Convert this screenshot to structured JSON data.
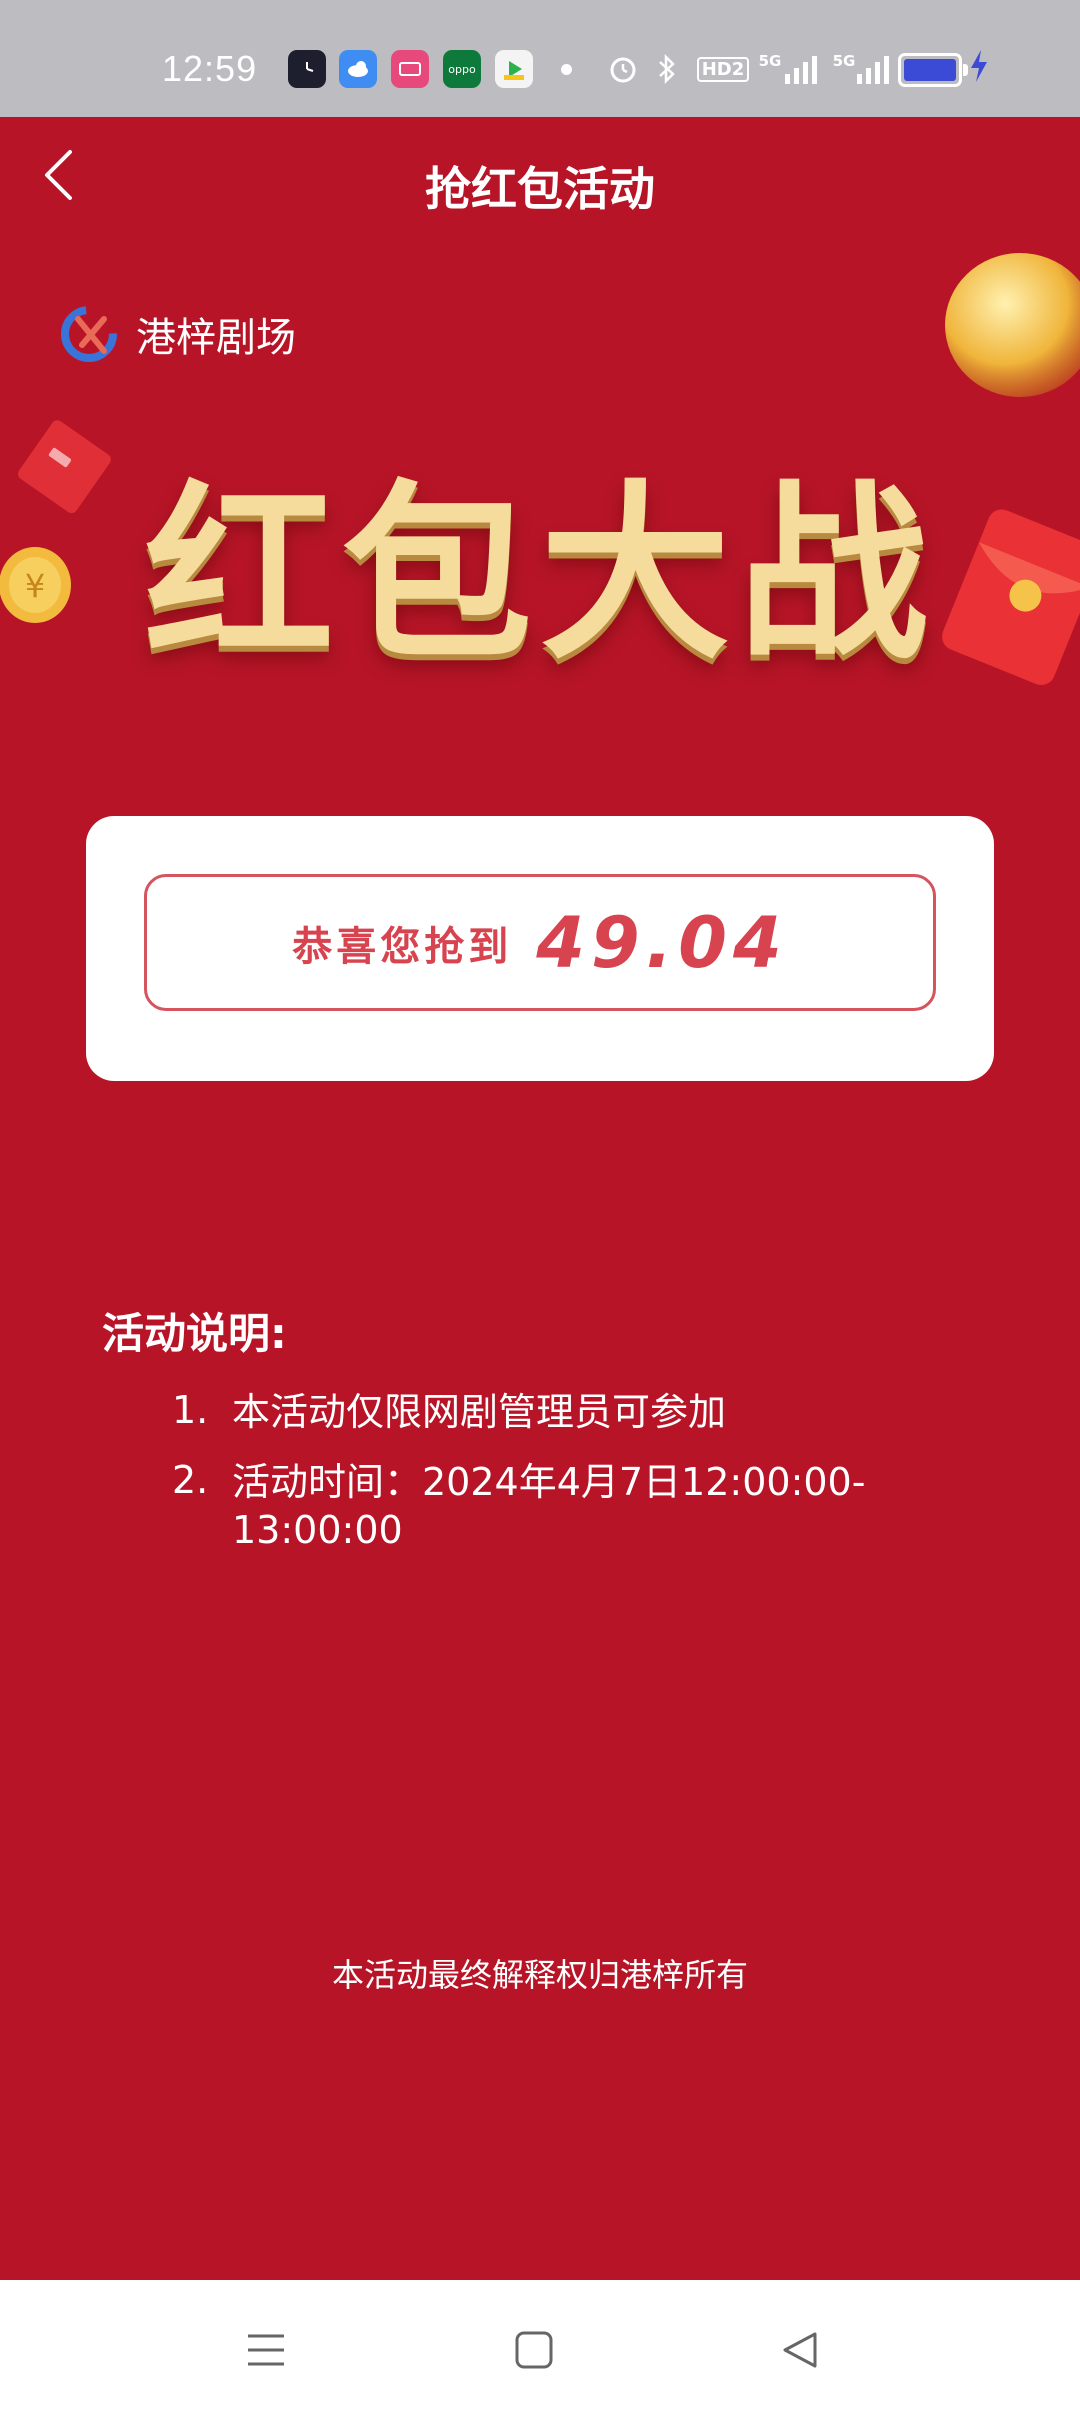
{
  "status_bar": {
    "time": "12:59",
    "apps": [
      "clock-app-icon",
      "weather-app-icon",
      "video-app-icon",
      "oppo-app-icon",
      "media-app-icon"
    ],
    "oppo_text": "oppo",
    "hd_label": "HD2",
    "signal1_label": "5G",
    "signal2_label": "5G"
  },
  "header": {
    "title": "抢红包活动"
  },
  "brand": {
    "name": "港梓剧场"
  },
  "banner": {
    "headline": "红包大战"
  },
  "result": {
    "label": "恭喜您抢到",
    "amount": "49.04"
  },
  "rules": {
    "title": "活动说明:",
    "items": [
      {
        "num": "1.",
        "text": "本活动仅限网剧管理员可参加"
      },
      {
        "num": "2.",
        "text": "活动时间：2024年4月7日12:00:00-13:00:00"
      }
    ]
  },
  "footer": {
    "note": "本活动最终解释权归港梓所有"
  },
  "colors": {
    "background": "#b71527",
    "accent": "#d7434e",
    "gold": "#f5dc9d"
  }
}
